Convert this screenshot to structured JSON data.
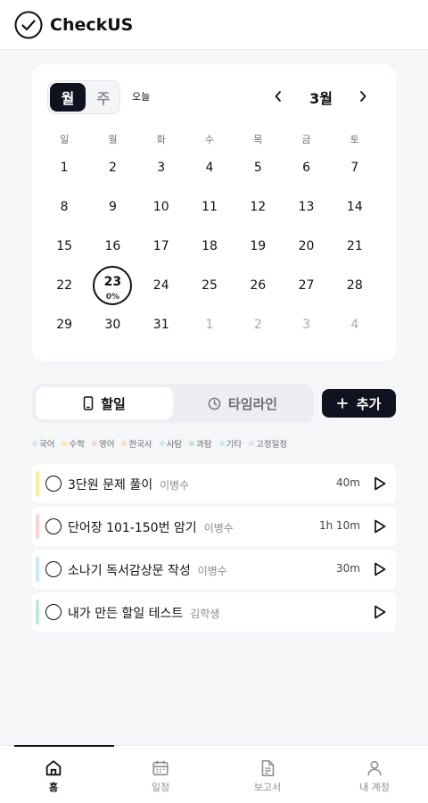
{
  "app": {
    "title": "CheckUS"
  },
  "calendar": {
    "view_month": "월",
    "view_week": "주",
    "today": "오늘",
    "month": "3월",
    "weekdays": [
      "일",
      "월",
      "화",
      "수",
      "목",
      "금",
      "토"
    ],
    "weeks": [
      [
        1,
        2,
        3,
        4,
        5,
        6,
        7
      ],
      [
        8,
        9,
        10,
        11,
        12,
        13,
        14
      ],
      [
        15,
        16,
        17,
        18,
        19,
        20,
        21
      ],
      [
        22,
        23,
        24,
        25,
        26,
        27,
        28
      ],
      [
        29,
        30,
        31,
        1,
        2,
        3,
        4
      ]
    ],
    "selected": {
      "day": "23",
      "progress": "0%"
    }
  },
  "tabs": {
    "todo": "할일",
    "timeline": "타임라인",
    "add": "추가"
  },
  "legend": [
    {
      "label": "국어",
      "color": "#cfe6fb"
    },
    {
      "label": "수학",
      "color": "#fbe9a0"
    },
    {
      "label": "영어",
      "color": "#fad3d3"
    },
    {
      "label": "한국사",
      "color": "#fddcc0"
    },
    {
      "label": "사탐",
      "color": "#c8eef6"
    },
    {
      "label": "과탐",
      "color": "#bdebd2"
    },
    {
      "label": "기타",
      "color": "#c6f2e6"
    },
    {
      "label": "고정일정",
      "color": "#e4e6ea"
    }
  ],
  "todos": [
    {
      "title": "3단원 문제 풀이",
      "assignee": "이병수",
      "duration": "40m",
      "color": "#fbe9a0"
    },
    {
      "title": "단어장 101-150번 암기",
      "assignee": "이병수",
      "duration": "1h 10m",
      "color": "#fad3d3"
    },
    {
      "title": "소나기 독서감상문 작성",
      "assignee": "이병수",
      "duration": "30m",
      "color": "#cfe6fb"
    },
    {
      "title": "내가 만든 할일 테스트",
      "assignee": "김학생",
      "duration": "",
      "color": "#bdebd2"
    }
  ],
  "nav": [
    {
      "label": "홈",
      "icon": "home-icon",
      "active": true
    },
    {
      "label": "일정",
      "icon": "calendar-icon",
      "active": false
    },
    {
      "label": "보고서",
      "icon": "report-icon",
      "active": false
    },
    {
      "label": "내 계정",
      "icon": "account-icon",
      "active": false
    }
  ]
}
